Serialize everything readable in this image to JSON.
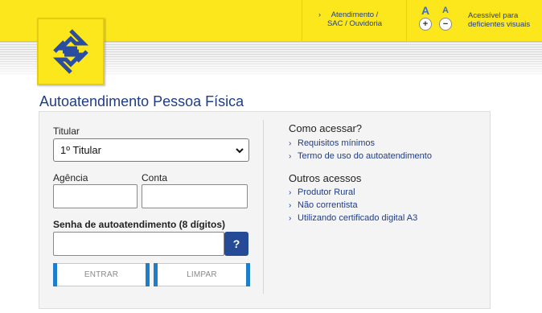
{
  "header": {
    "sac_link": {
      "line1": "Atendimento /",
      "line2": "SAC / Ouvidoria"
    },
    "font_controls": {
      "increase_letter": "A",
      "increase_symbol": "+",
      "decrease_letter": "A",
      "decrease_symbol": "−"
    },
    "accessibility": {
      "line1": "Acessível para",
      "line2": "deficientes visuais"
    },
    "brand_color": "#fce61c",
    "accent_blue": "#1f3d86"
  },
  "page_title": "Autoatendimento Pessoa Física",
  "form": {
    "titular_label": "Titular",
    "titular_value": "1º Titular",
    "agencia_label": "Agência",
    "agencia_value": "",
    "conta_label": "Conta",
    "conta_value": "",
    "senha_label": "Senha de autoatendimento (8 dígitos)",
    "senha_value": "",
    "help_label": "?",
    "enter_label": "ENTRAR",
    "clear_label": "LIMPAR"
  },
  "access": {
    "title": "Como acessar?",
    "links": [
      "Requisitos mínimos",
      "Termo de uso do autoatendimento"
    ]
  },
  "other": {
    "title": "Outros acessos",
    "links": [
      "Produtor Rural",
      "Não correntista",
      "Utilizando certificado digital A3"
    ]
  }
}
